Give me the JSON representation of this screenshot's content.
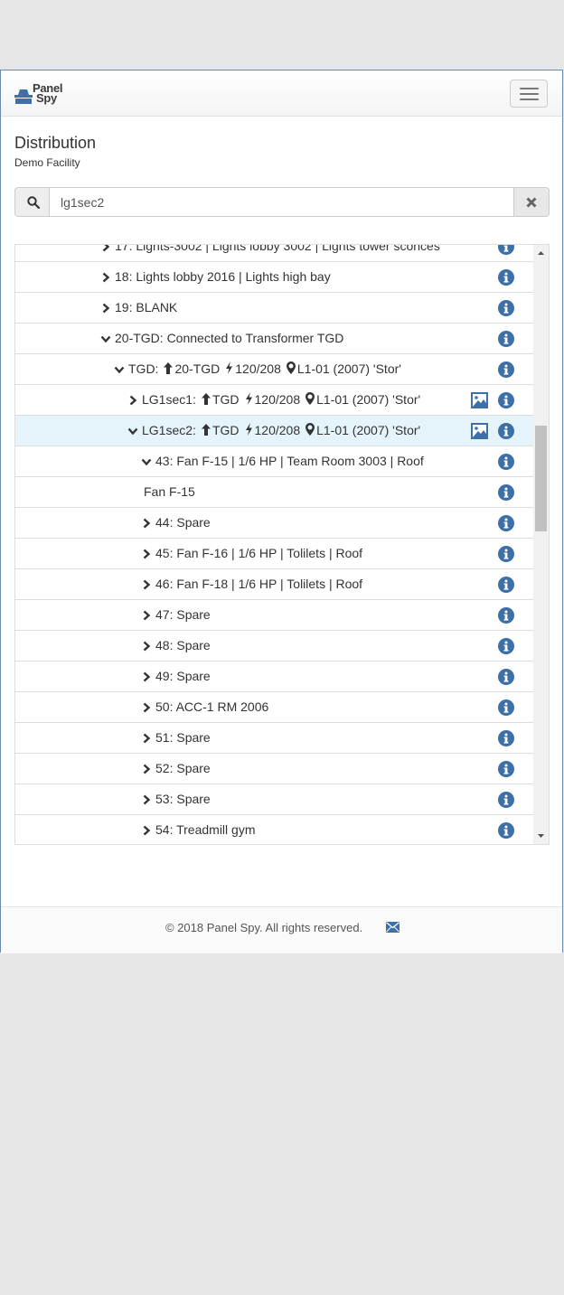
{
  "brand": {
    "logo_line1": "Panel",
    "logo_line2": "Spy"
  },
  "header": {
    "title": "Distribution",
    "subtitle": "Demo Facility"
  },
  "search": {
    "value": "lg1sec2"
  },
  "tree_rows": [
    {
      "indent": 1,
      "chevron": "right",
      "label": "17: Lights-3002 | Lights lobby 3002 | Lights tower sconces"
    },
    {
      "indent": 1,
      "chevron": "right",
      "label": "18: Lights lobby 2016 | Lights high bay"
    },
    {
      "indent": 1,
      "chevron": "right",
      "label": "19: BLANK"
    },
    {
      "indent": 1,
      "chevron": "down",
      "label": "20-TGD: Connected to Transformer TGD"
    },
    {
      "indent": 2,
      "chevron": "down",
      "name": "TGD:",
      "fed_from": "20-TGD",
      "voltage": "120/208",
      "location": "L1-01 (2007) 'Stor'"
    },
    {
      "indent": 3,
      "chevron": "right",
      "name": "LG1sec1:",
      "fed_from": "TGD",
      "voltage": "120/208",
      "location": "L1-01 (2007) 'Stor'",
      "has_image": true
    },
    {
      "indent": 3,
      "chevron": "down",
      "name": "LG1sec2:",
      "fed_from": "TGD",
      "voltage": "120/208",
      "location": "L1-01 (2007) 'Stor'",
      "has_image": true,
      "selected": true
    },
    {
      "indent": 4,
      "chevron": "down",
      "label": "43: Fan F-15 | 1/6 HP | Team Room 3003 | Roof"
    },
    {
      "indent": 5,
      "chevron": "none",
      "label": "Fan F-15"
    },
    {
      "indent": 4,
      "chevron": "right",
      "label": "44: Spare"
    },
    {
      "indent": 4,
      "chevron": "right",
      "label": "45: Fan F-16 | 1/6 HP | Tolilets | Roof"
    },
    {
      "indent": 4,
      "chevron": "right",
      "label": "46: Fan F-18 | 1/6 HP | Tolilets | Roof"
    },
    {
      "indent": 4,
      "chevron": "right",
      "label": "47: Spare"
    },
    {
      "indent": 4,
      "chevron": "right",
      "label": "48: Spare"
    },
    {
      "indent": 4,
      "chevron": "right",
      "label": "49: Spare"
    },
    {
      "indent": 4,
      "chevron": "right",
      "label": "50: ACC-1 RM 2006"
    },
    {
      "indent": 4,
      "chevron": "right",
      "label": "51: Spare"
    },
    {
      "indent": 4,
      "chevron": "right",
      "label": "52: Spare"
    },
    {
      "indent": 4,
      "chevron": "right",
      "label": "53: Spare"
    },
    {
      "indent": 4,
      "chevron": "right",
      "label": "54: Treadmill gym"
    }
  ],
  "icons": {
    "search": "search-icon",
    "clear": "close-icon",
    "menu": "hamburger-icon",
    "info": "info-circle-icon",
    "image": "image-icon",
    "mail": "envelope-icon",
    "arrow": "arrow-up-icon",
    "bolt": "bolt-icon",
    "pin": "map-marker-icon"
  },
  "colors": {
    "accent": "#3d6fa8",
    "selected_row": "#e5f4fb",
    "text": "#333333"
  },
  "footer": {
    "copyright": "© 2018 Panel Spy. All rights reserved."
  }
}
